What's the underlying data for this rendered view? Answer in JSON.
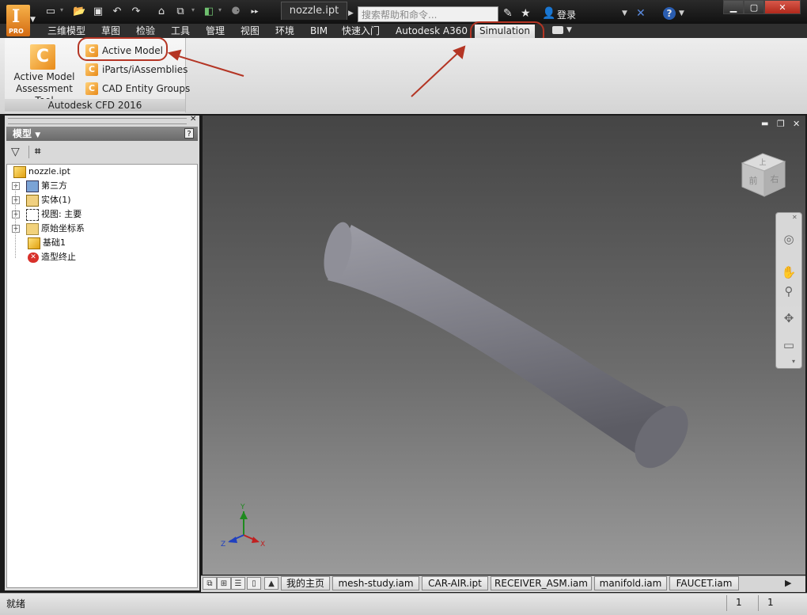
{
  "app": {
    "pro_label": "PRO",
    "glyph": "I"
  },
  "document_tab": "nozzle.ipt",
  "search": {
    "placeholder": "搜索帮助和命令..."
  },
  "login": "登录",
  "ribbon_tabs": [
    "三维模型",
    "草图",
    "检验",
    "工具",
    "管理",
    "视图",
    "环境",
    "BIM",
    "快速入门",
    "Autodesk A360",
    "Simulation"
  ],
  "ribbon": {
    "big_button_label": "Active Model Assessment Tool",
    "items": [
      "Active Model",
      "iParts/iAssemblies",
      "CAD Entity Groups"
    ],
    "panel_title": "Autodesk CFD 2016"
  },
  "browser": {
    "title": "模型",
    "tree": [
      {
        "label": "nozzle.ipt",
        "icon": "part-icon"
      },
      {
        "label": "第三方",
        "icon": "third-party-icon"
      },
      {
        "label": "实体(1)",
        "icon": "solid-bodies-icon"
      },
      {
        "label": "视图: 主要",
        "icon": "view-icon"
      },
      {
        "label": "原始坐标系",
        "icon": "origin-folder-icon"
      },
      {
        "label": "基础1",
        "icon": "base-feature-icon"
      },
      {
        "label": "造型终止",
        "icon": "end-of-part-icon"
      }
    ]
  },
  "viewcube": {
    "front": "前",
    "top": "上",
    "right": "右"
  },
  "triad": {
    "x": "X",
    "y": "Y",
    "z": "Z"
  },
  "doc_tabs": [
    "我的主页",
    "mesh-study.iam",
    "CAR-AIR.ipt",
    "RECEIVER_ASM.iam",
    "manifold.iam",
    "FAUCET.iam"
  ],
  "status": {
    "text": "就绪",
    "count1": "1",
    "count2": "1"
  },
  "colors": {
    "highlight": "#b43524",
    "app_orange": "#e07a1a"
  }
}
